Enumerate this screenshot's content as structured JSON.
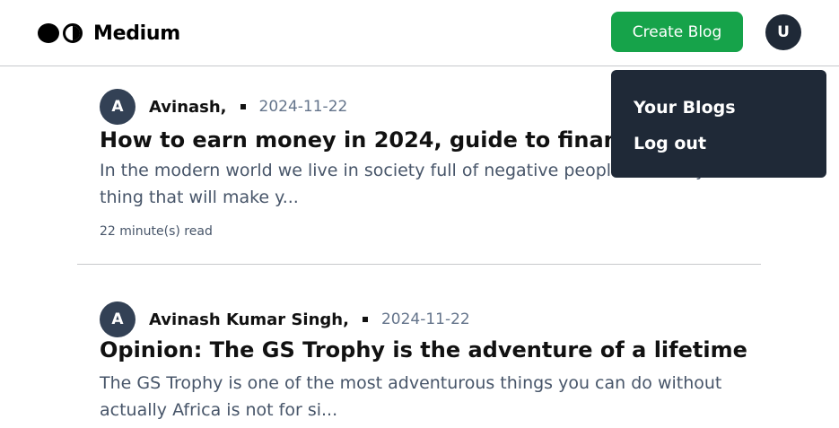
{
  "header": {
    "brand_name": "Medium",
    "create_button_label": "Create Blog",
    "user_initial": "U"
  },
  "dropdown": {
    "items": [
      {
        "label": "Your Blogs"
      },
      {
        "label": "Log out"
      }
    ]
  },
  "posts": [
    {
      "author_initial": "A",
      "author": "Avinash,",
      "date": "2024-11-22",
      "title": "How to earn money in 2024, guide to financial freedom",
      "excerpt": "In the modern world we live in society full of negative people. The only thing that will make y...",
      "read_time": "22 minute(s) read"
    },
    {
      "author_initial": "A",
      "author": "Avinash Kumar Singh,",
      "date": "2024-11-22",
      "title": "Opinion: The GS Trophy is the adventure of a lifetime",
      "excerpt": "The GS Trophy is one of the most adventurous things you can do without actually Africa is not for si..."
    }
  ],
  "colors": {
    "primary_button": "#16a34a",
    "dropdown_bg": "#1f2937",
    "avatar_bg": "#334155"
  }
}
